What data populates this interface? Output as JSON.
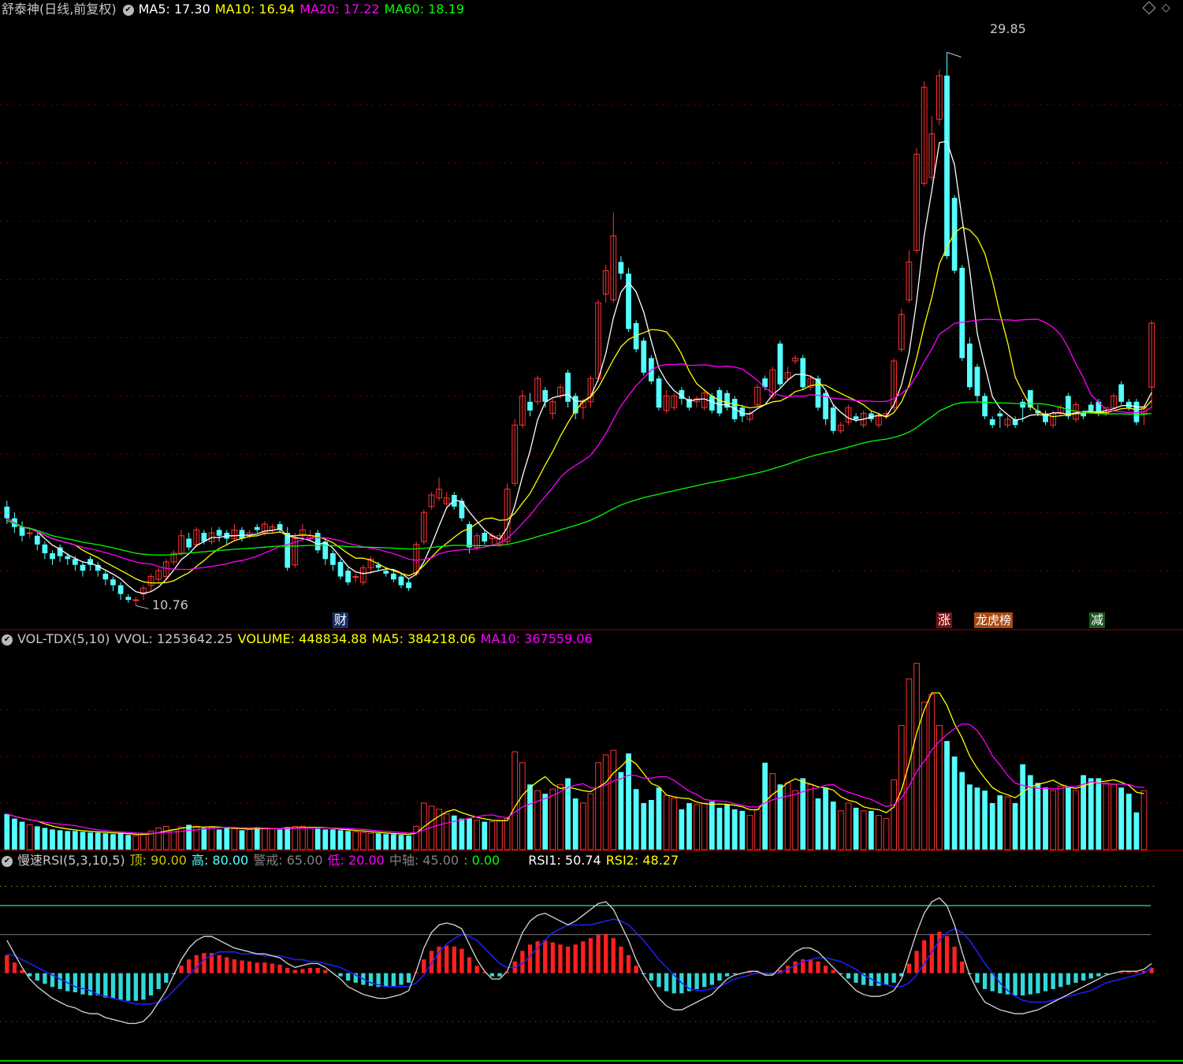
{
  "colors": {
    "up": "#ff3232",
    "down": "#54ffff",
    "ma5": "#ffffff",
    "ma10": "#ffff00",
    "ma20": "#ff00ff",
    "ma60": "#00ff00",
    "grid": "#7a0000",
    "border": "#a00000"
  },
  "main": {
    "title": "舒泰神(日线,前复权)",
    "ma5": "MA5: 17.30",
    "ma10": "MA10: 16.94",
    "ma20": "MA20: 17.22",
    "ma60": "MA60: 18.19",
    "high_label": "29.85",
    "low_label": "10.76",
    "event_tags": [
      "财",
      "涨",
      "龙虎榜",
      "减"
    ],
    "diamond_icon": "diamond-icon",
    "menu_icon": "window-menu-icon"
  },
  "vol": {
    "title": "VOL-TDX(5,10)",
    "vvol": "VVOL: 1253642.25",
    "volume": "VOLUME: 448834.88",
    "ma5": "MA5: 384218.06",
    "ma10": "MA10: 367559.06"
  },
  "rsi": {
    "title": "慢速RSI(5,3,10,5)",
    "top": "顶: 90.00",
    "high": "高: 80.00",
    "warn": "警戒: 65.00",
    "low": "低: 20.00",
    "mid": "中轴: 45.00",
    "zero": ": 0.00",
    "rsi1": "RSI1: 50.74",
    "rsi2": "RSI2: 48.27"
  },
  "chart_data": [
    {
      "type": "candlestick",
      "title": "舒泰神(日线,前复权)",
      "ylim": [
        10.0,
        31.0
      ],
      "y_ticks": [
        12,
        14,
        16,
        18,
        20,
        22,
        24,
        26,
        28
      ],
      "series": [
        {
          "name": "MA5",
          "values": "computed"
        },
        {
          "name": "MA10",
          "values": "computed"
        },
        {
          "name": "MA20",
          "values": "computed"
        },
        {
          "name": "MA60",
          "values": "computed"
        }
      ],
      "ohlc_open": [
        14.2,
        13.8,
        13.5,
        13.3,
        13.2,
        12.9,
        12.6,
        12.8,
        12.5,
        12.4,
        12.2,
        12.4,
        12.2,
        11.9,
        11.7,
        11.5,
        11.1,
        11.0,
        11.2,
        11.5,
        11.7,
        11.8,
        12.3,
        12.6,
        13.1,
        12.9,
        13.3,
        13.0,
        13.4,
        13.3,
        13.1,
        13.4,
        13.2,
        13.5,
        13.3,
        13.4,
        13.6,
        13.3,
        12.2,
        13.2,
        13.1,
        13.3,
        13.0,
        12.6,
        12.3,
        12.0,
        11.8,
        11.6,
        12.1,
        12.2,
        12.0,
        11.9,
        11.8,
        11.6,
        11.9,
        13.0,
        14.2,
        14.5,
        14.3,
        14.6,
        14.4,
        13.6,
        12.8,
        13.3,
        13.1,
        12.9,
        13.0,
        15.0,
        17.0,
        17.8,
        17.8,
        18.2,
        17.4,
        18.0,
        18.8,
        18.0,
        17.6,
        17.8,
        18.6,
        21.5,
        21.3,
        22.6,
        22.2,
        20.5,
        19.9,
        19.3,
        18.6,
        17.5,
        17.6,
        18.2,
        17.9,
        17.8,
        17.6,
        18.0,
        18.2,
        18.1,
        17.9,
        17.6,
        17.2,
        17.7,
        18.6,
        18.0,
        19.8,
        18.6,
        19.2,
        19.3,
        18.3,
        18.6,
        18.1,
        17.6,
        16.8,
        17.1,
        17.3,
        17.0,
        17.4,
        17.0,
        17.3,
        17.6,
        19.6,
        21.3,
        23.0,
        25.3,
        25.5,
        27.5,
        29.0,
        24.8,
        22.4,
        19.8,
        19.0,
        18.0,
        17.2,
        17.4,
        17.0,
        17.2,
        17.8,
        18.2,
        17.5,
        17.4,
        17.0,
        17.4,
        18.0,
        17.2,
        17.4,
        17.7,
        17.8,
        17.4,
        17.6,
        18.4,
        17.8,
        17.8,
        17.4,
        18.3
      ],
      "ohlc_close": [
        13.8,
        13.5,
        13.2,
        13.3,
        12.9,
        12.6,
        12.4,
        12.5,
        12.4,
        12.2,
        12.0,
        12.2,
        12.0,
        11.7,
        11.5,
        11.2,
        11.0,
        11.0,
        11.4,
        11.8,
        12.0,
        12.3,
        12.6,
        13.2,
        12.8,
        13.4,
        13.0,
        13.3,
        13.2,
        13.1,
        13.4,
        13.1,
        13.3,
        13.4,
        13.6,
        13.5,
        13.4,
        12.1,
        13.1,
        13.4,
        13.2,
        12.7,
        12.4,
        12.2,
        11.8,
        11.6,
        11.8,
        12.1,
        12.4,
        12.1,
        11.9,
        11.7,
        11.5,
        11.4,
        12.9,
        14.0,
        14.6,
        14.8,
        14.5,
        14.2,
        13.8,
        12.8,
        13.2,
        13.0,
        13.2,
        13.2,
        14.8,
        17.0,
        18.0,
        17.5,
        18.6,
        17.8,
        17.8,
        18.3,
        17.8,
        17.4,
        17.8,
        18.6,
        21.2,
        22.3,
        23.5,
        22.2,
        20.3,
        19.6,
        18.8,
        18.5,
        17.6,
        18.0,
        18.0,
        17.9,
        17.6,
        17.9,
        18.1,
        17.5,
        17.4,
        17.6,
        17.2,
        17.3,
        17.4,
        18.3,
        18.3,
        18.9,
        18.4,
        18.8,
        19.3,
        18.3,
        18.6,
        17.6,
        17.2,
        16.8,
        17.0,
        17.6,
        17.2,
        17.4,
        17.2,
        17.3,
        17.4,
        19.2,
        20.8,
        22.6,
        26.3,
        28.6,
        27.0,
        29.0,
        22.8,
        22.3,
        19.3,
        18.3,
        18.0,
        17.3,
        17.0,
        17.3,
        17.2,
        17.0,
        17.6,
        17.6,
        17.4,
        17.1,
        17.4,
        17.6,
        17.3,
        17.7,
        17.3,
        17.5,
        17.4,
        17.6,
        18.0,
        17.8,
        17.6,
        17.1,
        17.6,
        20.5
      ],
      "ohlc_high": [
        14.4,
        14.0,
        13.7,
        13.5,
        13.3,
        13.0,
        12.7,
        12.9,
        12.6,
        12.5,
        12.3,
        12.5,
        12.3,
        12.0,
        11.8,
        11.6,
        11.2,
        11.1,
        11.5,
        11.9,
        12.1,
        12.4,
        12.7,
        13.4,
        13.3,
        13.5,
        13.4,
        13.5,
        13.5,
        13.4,
        13.6,
        13.5,
        13.4,
        13.6,
        13.7,
        13.6,
        13.7,
        13.5,
        13.3,
        13.6,
        13.4,
        13.4,
        13.1,
        12.7,
        12.4,
        12.1,
        11.9,
        12.2,
        12.5,
        12.3,
        12.1,
        12.0,
        11.9,
        11.7,
        13.0,
        14.1,
        14.7,
        15.2,
        14.7,
        14.7,
        14.5,
        13.7,
        13.3,
        13.4,
        13.3,
        13.3,
        15.0,
        17.2,
        18.2,
        18.1,
        18.7,
        18.3,
        17.9,
        18.4,
        18.9,
        18.1,
        17.9,
        18.7,
        21.3,
        22.5,
        24.3,
        22.8,
        22.4,
        20.6,
        20.0,
        19.4,
        18.7,
        18.2,
        18.1,
        18.3,
        18.0,
        18.0,
        18.2,
        18.1,
        18.3,
        18.2,
        18.0,
        17.7,
        17.5,
        18.4,
        18.7,
        19.0,
        19.9,
        19.0,
        19.4,
        19.4,
        18.7,
        18.7,
        18.2,
        17.7,
        17.1,
        17.7,
        17.4,
        17.5,
        17.5,
        17.4,
        17.5,
        19.3,
        21.0,
        23.0,
        26.5,
        28.8,
        27.6,
        29.2,
        29.8,
        24.9,
        22.5,
        20.0,
        19.1,
        18.1,
        17.3,
        17.5,
        17.3,
        17.3,
        17.9,
        18.2,
        17.7,
        17.5,
        17.5,
        17.7,
        18.1,
        17.8,
        17.5,
        17.8,
        17.9,
        17.6,
        18.1,
        18.5,
        17.9,
        17.9,
        17.7,
        20.6
      ],
      "ohlc_low": [
        13.6,
        13.3,
        13.0,
        13.1,
        12.7,
        12.4,
        12.2,
        12.3,
        12.2,
        12.0,
        11.8,
        12.0,
        11.8,
        11.5,
        11.3,
        11.0,
        10.9,
        10.8,
        11.0,
        11.3,
        11.6,
        11.7,
        12.2,
        12.5,
        12.7,
        12.8,
        12.9,
        12.9,
        13.0,
        12.9,
        13.0,
        13.0,
        13.1,
        13.3,
        13.2,
        13.3,
        13.3,
        12.0,
        12.1,
        13.1,
        13.0,
        12.6,
        12.2,
        12.0,
        11.7,
        11.5,
        11.6,
        11.5,
        11.9,
        12.0,
        11.8,
        11.6,
        11.4,
        11.3,
        11.8,
        12.9,
        14.1,
        14.4,
        14.2,
        14.1,
        13.7,
        12.6,
        12.7,
        12.9,
        12.9,
        12.8,
        12.9,
        14.9,
        16.9,
        17.3,
        17.7,
        17.6,
        17.2,
        17.9,
        17.6,
        17.2,
        17.2,
        17.6,
        18.5,
        21.2,
        21.2,
        22.0,
        20.2,
        19.5,
        18.7,
        18.4,
        17.5,
        17.4,
        17.5,
        17.7,
        17.5,
        17.6,
        17.5,
        17.4,
        17.3,
        17.5,
        17.1,
        17.1,
        17.1,
        17.6,
        18.2,
        17.9,
        18.3,
        18.5,
        19.1,
        18.2,
        18.2,
        17.5,
        17.0,
        16.7,
        16.7,
        17.0,
        17.1,
        16.9,
        17.1,
        16.9,
        17.2,
        17.5,
        19.5,
        21.2,
        22.9,
        25.2,
        25.4,
        27.3,
        22.7,
        22.2,
        19.2,
        18.2,
        17.8,
        17.2,
        16.9,
        16.9,
        16.9,
        16.9,
        17.1,
        17.5,
        17.3,
        17.0,
        16.9,
        17.3,
        17.2,
        17.1,
        17.2,
        17.4,
        17.3,
        17.3,
        17.5,
        17.7,
        17.5,
        17.0,
        17.0,
        17.6
      ],
      "annotations": [
        "29.85",
        "10.76",
        "财",
        "涨",
        "龙虎榜",
        "减"
      ]
    },
    {
      "type": "bar",
      "title": "VOL-TDX(5,10)",
      "ylim": [
        0,
        1300000
      ],
      "series": [
        {
          "name": "VOLUME",
          "values": [
            230000,
            200000,
            180000,
            160000,
            150000,
            140000,
            130000,
            125000,
            120000,
            120000,
            115000,
            110000,
            110000,
            105000,
            100000,
            105000,
            95000,
            90000,
            100000,
            120000,
            140000,
            150000,
            130000,
            145000,
            160000,
            150000,
            140000,
            145000,
            130000,
            140000,
            135000,
            125000,
            130000,
            145000,
            140000,
            135000,
            130000,
            145000,
            150000,
            150000,
            140000,
            135000,
            130000,
            130000,
            125000,
            120000,
            115000,
            110000,
            105000,
            105000,
            100000,
            100000,
            95000,
            90000,
            150000,
            300000,
            280000,
            260000,
            230000,
            220000,
            200000,
            200000,
            190000,
            180000,
            180000,
            185000,
            200000,
            630000,
            560000,
            420000,
            380000,
            360000,
            390000,
            420000,
            460000,
            330000,
            300000,
            360000,
            560000,
            610000,
            640000,
            500000,
            620000,
            390000,
            300000,
            320000,
            400000,
            350000,
            330000,
            260000,
            300000,
            290000,
            300000,
            310000,
            270000,
            290000,
            260000,
            250000,
            220000,
            260000,
            560000,
            490000,
            420000,
            430000,
            380000,
            460000,
            420000,
            330000,
            400000,
            310000,
            250000,
            300000,
            270000,
            250000,
            250000,
            220000,
            200000,
            450000,
            800000,
            1100000,
            1200000,
            950000,
            1000000,
            800000,
            700000,
            600000,
            500000,
            420000,
            400000,
            380000,
            300000,
            350000,
            340000,
            300000,
            550000,
            480000,
            430000,
            400000,
            380000,
            410000,
            400000,
            380000,
            480000,
            460000,
            460000,
            430000,
            420000,
            400000,
            360000,
            240000,
            380000
          ]
        }
      ],
      "extra": {
        "VVOL": 1253642.25,
        "MA5": 384218.06,
        "MA10": 367559.06
      }
    },
    {
      "type": "line",
      "title": "慢速RSI(5,3,10,5)",
      "ylim": [
        0,
        100
      ],
      "levels": {
        "顶": 90,
        "高": 80,
        "警戒": 65,
        "低": 20,
        "中轴": 45,
        "0": 0
      },
      "series": [
        {
          "name": "RSI1",
          "values": [
            62,
            55,
            48,
            42,
            38,
            35,
            32,
            30,
            28,
            27,
            25,
            24,
            24,
            22,
            21,
            20,
            19,
            19,
            20,
            24,
            30,
            36,
            44,
            52,
            58,
            62,
            64,
            64,
            62,
            60,
            58,
            57,
            56,
            55,
            55,
            54,
            53,
            50,
            48,
            49,
            50,
            50,
            48,
            45,
            42,
            38,
            36,
            34,
            33,
            32,
            32,
            33,
            34,
            36,
            46,
            58,
            66,
            70,
            71,
            70,
            68,
            60,
            52,
            46,
            42,
            42,
            46,
            56,
            66,
            72,
            75,
            76,
            74,
            72,
            70,
            72,
            75,
            78,
            81,
            82,
            78,
            70,
            62,
            52,
            44,
            38,
            32,
            28,
            26,
            26,
            28,
            30,
            32,
            34,
            38,
            42,
            44,
            45,
            46,
            46,
            44,
            44,
            48,
            52,
            56,
            58,
            58,
            56,
            52,
            48,
            44,
            40,
            36,
            34,
            33,
            33,
            34,
            36,
            42,
            54,
            66,
            76,
            82,
            84,
            80,
            70,
            56,
            44,
            36,
            30,
            28,
            26,
            25,
            24,
            24,
            25,
            26,
            28,
            30,
            32,
            34,
            36,
            38,
            40,
            42,
            44,
            45,
            46,
            46,
            46,
            47,
            50
          ]
        },
        {
          "name": "RSI2",
          "values": [
            55,
            54,
            52,
            50,
            48,
            46,
            44,
            42,
            40,
            38,
            37,
            36,
            34,
            33,
            32,
            31,
            30,
            29,
            29,
            29,
            30,
            32,
            36,
            40,
            44,
            48,
            52,
            54,
            56,
            56,
            56,
            55,
            55,
            55,
            54,
            54,
            54,
            53,
            52,
            52,
            51,
            51,
            50,
            49,
            48,
            46,
            44,
            42,
            40,
            39,
            38,
            38,
            38,
            38,
            40,
            44,
            50,
            56,
            60,
            63,
            65,
            64,
            62,
            58,
            54,
            50,
            48,
            48,
            50,
            54,
            58,
            62,
            66,
            68,
            70,
            70,
            70,
            70,
            71,
            72,
            73,
            72,
            70,
            66,
            62,
            57,
            52,
            48,
            44,
            40,
            37,
            36,
            36,
            37,
            38,
            40,
            42,
            43,
            44,
            45,
            45,
            45,
            45,
            47,
            49,
            51,
            52,
            53,
            53,
            52,
            51,
            49,
            47,
            44,
            42,
            40,
            39,
            38,
            38,
            40,
            44,
            50,
            56,
            62,
            66,
            68,
            66,
            62,
            56,
            50,
            45,
            40,
            36,
            33,
            31,
            30,
            30,
            30,
            31,
            32,
            33,
            34,
            35,
            36,
            38,
            40,
            41,
            42,
            43,
            44,
            45,
            48
          ]
        }
      ],
      "extra": {
        "RSI1": 50.74,
        "RSI2": 48.27
      }
    }
  ]
}
